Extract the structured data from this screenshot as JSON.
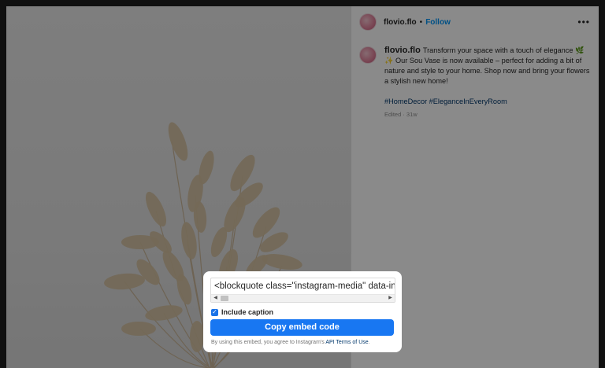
{
  "post": {
    "username": "flovio.flo",
    "separator": "•",
    "follow_label": "Follow",
    "more_icon": "more-horizontal-icon",
    "caption": {
      "username": "flovio.flo",
      "text": "Transform your space with a touch of elegance 🌿✨ Our Sou Vase is now available – perfect for adding a bit of nature and style to your home. Shop now and bring your flowers a stylish new home!",
      "hashtags": "#HomeDecor #EleganceInEveryRoom",
      "meta": "Edited · 31w"
    }
  },
  "embed_dialog": {
    "code_text": "<blockquote class=\"instagram-media\" data-instgrm-captioned",
    "include_caption_label": "Include caption",
    "include_caption_checked": true,
    "copy_button_label": "Copy embed code",
    "terms_text": "By using this embed, you agree to Instagram's",
    "terms_link": "API Terms of Use",
    "terms_end": "."
  },
  "colors": {
    "accent": "#1877f2",
    "follow": "#0095f6",
    "hashtag": "#00376b"
  }
}
